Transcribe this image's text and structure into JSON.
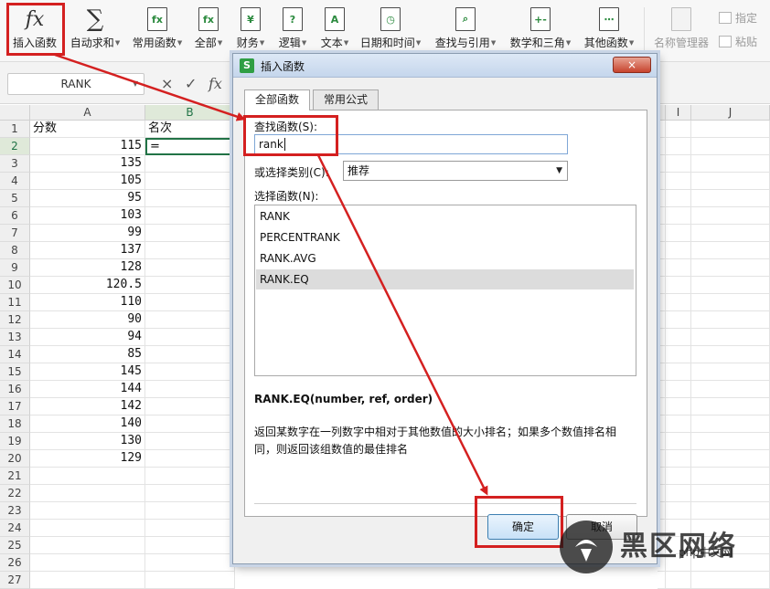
{
  "ribbon": {
    "insert_function": "插入函数",
    "autosum": "自动求和",
    "common_functions": "常用函数",
    "all": "全部",
    "financial": "财务",
    "logical": "逻辑",
    "text": "文本",
    "datetime": "日期和时间",
    "lookup": "查找与引用",
    "math": "数学和三角",
    "other": "其他函数",
    "name_manager": "名称管理器",
    "specify": "指定",
    "paste": "粘贴",
    "fx_glyph": "fx",
    "sigma_glyph": "∑",
    "ico_fx_small": "fx",
    "ico_fx2": "fx",
    "ico_yen": "¥",
    "ico_q": "?",
    "ico_a": "A",
    "ico_clock": "◷",
    "ico_search": "⌕",
    "ico_math": "+-",
    "ico_dots": "⋯"
  },
  "formula_bar": {
    "name_box": "RANK",
    "cancel": "×",
    "accept": "✓",
    "fx": "fx"
  },
  "sheet": {
    "columns": [
      "A",
      "B",
      "I",
      "J"
    ],
    "rows": [
      "1",
      "2",
      "3",
      "4",
      "5",
      "6",
      "7",
      "8",
      "9",
      "10",
      "11",
      "12",
      "13",
      "14",
      "15",
      "16",
      "17",
      "18",
      "19",
      "20",
      "21",
      "22",
      "23",
      "24",
      "25",
      "26",
      "27"
    ],
    "header_a": "分数",
    "header_b": "名次",
    "active_cell_value": "=",
    "scores": [
      "115",
      "135",
      "105",
      "95",
      "103",
      "99",
      "137",
      "128",
      "120.5",
      "110",
      "90",
      "94",
      "85",
      "145",
      "144",
      "142",
      "140",
      "130",
      "129"
    ]
  },
  "dialog": {
    "title": "插入函数",
    "close": "×",
    "tab_all": "全部函数",
    "tab_common": "常用公式",
    "search_label": "查找函数(S):",
    "search_value": "rank",
    "category_label": "或选择类别(C):",
    "category_value": "推荐",
    "select_label": "选择函数(N):",
    "functions": [
      "RANK",
      "PERCENTRANK",
      "RANK.AVG",
      "RANK.EQ"
    ],
    "signature": "RANK.EQ(number, ref, order)",
    "description_line1": "返回某数字在一列数字中相对于其他数值的大小排名；如果多个数值排名相",
    "description_line2": "同，则返回该组数值的最佳排名",
    "ok": "确定",
    "cancel": "取消"
  },
  "watermark": {
    "text": "黑区网络",
    "sub": "php中文网"
  },
  "colors": {
    "annotation_red": "#d42020",
    "selection_green": "#217346"
  }
}
